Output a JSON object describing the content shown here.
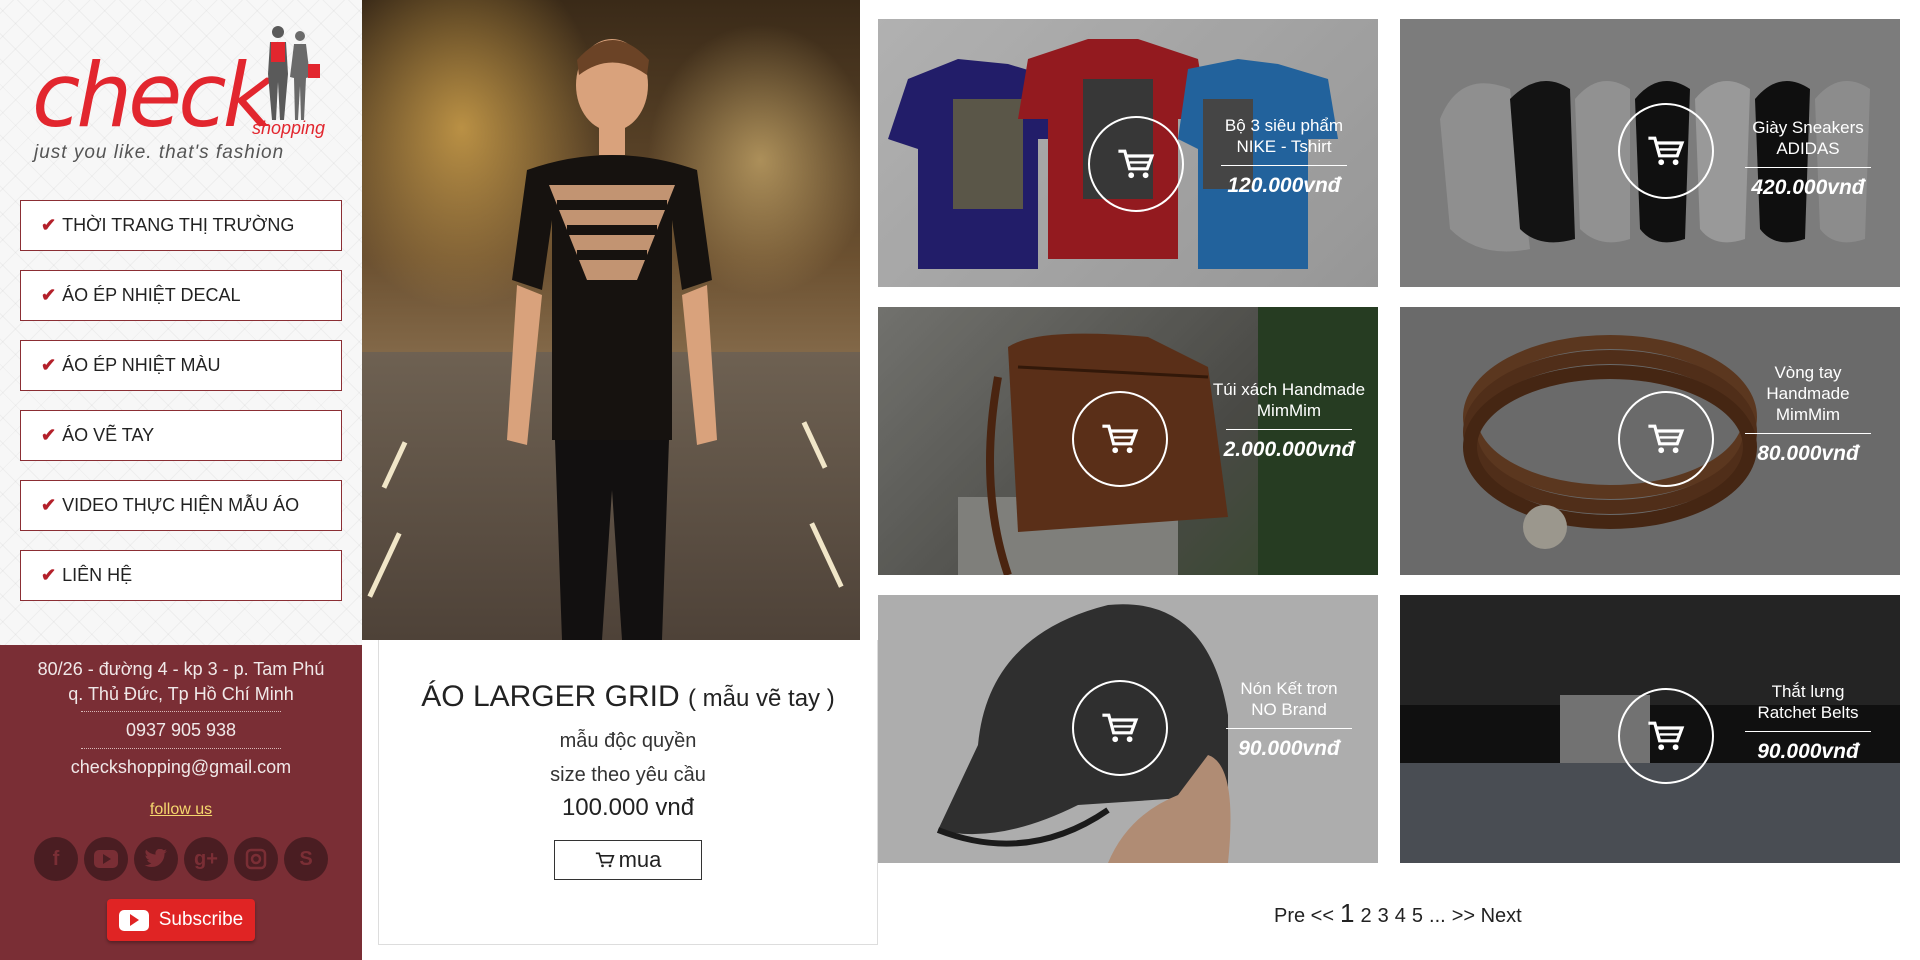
{
  "brand": {
    "word": "check",
    "sub": "shopping",
    "tagline": "just you like. that's fashion"
  },
  "menu": [
    {
      "label": "THỜI TRANG THỊ TRƯỜNG"
    },
    {
      "label": "ÁO ÉP NHIỆT DECAL"
    },
    {
      "label": "ÁO ÉP NHIỆT MÀU"
    },
    {
      "label": "ÁO VẼ TAY"
    },
    {
      "label": "VIDEO THỰC HIỆN MẪU ÁO"
    },
    {
      "label": "LIÊN HỆ"
    }
  ],
  "contact": {
    "address_line1": "80/26 - đường 4 - kp 3 - p. Tam Phú",
    "address_line2": "q. Thủ Đức, Tp Hồ Chí Minh",
    "phone": "0937 905 938",
    "email": "checkshopping@gmail.com",
    "follow": "follow us",
    "subscribe": "Subscribe"
  },
  "social_icons": [
    "facebook-icon",
    "youtube-icon",
    "twitter-icon",
    "google-plus-icon",
    "instagram-icon",
    "skype-icon"
  ],
  "feature": {
    "title": "ÁO LARGER GRID",
    "title_note": "( mẫu vẽ tay )",
    "line1": "mẫu độc quyền",
    "line2": "size theo yêu cầu",
    "price": "100.000 vnđ",
    "buy_label": "mua"
  },
  "products": [
    {
      "name": "Bộ 3 siêu phẩm NIKE - Tshirt",
      "price": "120.000vnđ"
    },
    {
      "name": "Giày Sneakers ADIDAS",
      "price": "420.000vnđ"
    },
    {
      "name": "Túi xách Handmade MimMim",
      "price": "2.000.000vnđ"
    },
    {
      "name": "Vòng tay Handmade MimMim",
      "price": "80.000vnđ"
    },
    {
      "name": "Nón Kết trơn NO Brand",
      "price": "90.000vnđ"
    },
    {
      "name": "Thắt lưng Ratchet Belts",
      "price": "90.000vnđ"
    }
  ],
  "pagination": {
    "prev": "Pre <<",
    "current": "1",
    "pages": [
      "2",
      "3",
      "4",
      "5"
    ],
    "ellipsis": "...",
    "next": ">> Next"
  },
  "colors": {
    "brand_red": "#e2262e",
    "sidebar_maroon": "#7a2e35",
    "follow_yellow": "#f5d76e",
    "subscribe_red": "#e02424"
  }
}
